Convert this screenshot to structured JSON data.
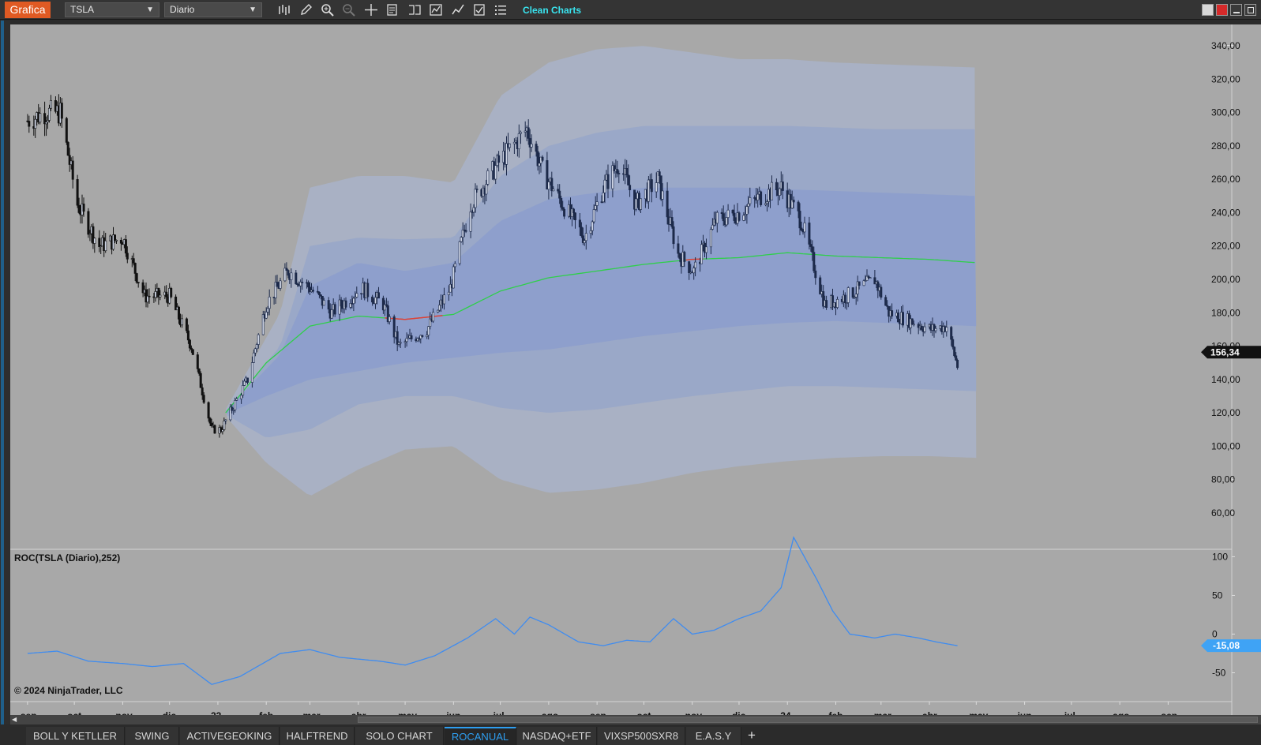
{
  "toolbar": {
    "brand": "Grafica",
    "instrument": "TSLA",
    "period": "Diario",
    "clean_charts": "Clean Charts",
    "tools": [
      "bar-type-icon",
      "pencil-icon",
      "zoom-in-icon",
      "zoom-out-icon",
      "crosshair-icon",
      "properties-icon",
      "strategies-icon",
      "indicators-icon",
      "chart-trader-icon",
      "templates-icon",
      "list-icon"
    ]
  },
  "colors": {
    "brand": "#e05a23",
    "accent_cyan": "#39e4ef",
    "chart_bg": "#a8a8a8",
    "band_outer": "#a9b1c4",
    "band_mid": "#9aa8c8",
    "band_inner": "#8e9fcc",
    "ma_up": "#2fcf4a",
    "ma_down": "#e0403a",
    "roc_line": "#3f8cf0",
    "last_price_badge": "#111111",
    "roc_badge": "#3fa3f5"
  },
  "price_panel": {
    "y_ticks": [
      "340,00",
      "320,00",
      "300,00",
      "280,00",
      "260,00",
      "240,00",
      "220,00",
      "200,00",
      "180,00",
      "160,00",
      "140,00",
      "120,00",
      "100,00",
      "80,00",
      "60,00"
    ],
    "last_price": "156,34",
    "nav_arrow": "←"
  },
  "roc_panel": {
    "title": "ROC(TSLA (Diario),252)",
    "y_ticks": [
      "100",
      "50",
      "0",
      "-50"
    ],
    "last_value": "-15,08",
    "copyright": "© 2024 NinjaTrader, LLC"
  },
  "x_axis": {
    "labels": [
      "sep",
      "oct",
      "nov",
      "dic",
      "23",
      "feb",
      "mar",
      "abr",
      "may",
      "jun",
      "jul",
      "ago",
      "sep",
      "oct",
      "nov",
      "dic",
      "24",
      "feb",
      "mar",
      "abr",
      "may",
      "jun",
      "jul",
      "ago",
      "sep"
    ]
  },
  "tabs": [
    {
      "label": "BOLL Y KETLLER",
      "active": false
    },
    {
      "label": "SWING",
      "active": false
    },
    {
      "label": "ACTIVEGEOKING",
      "active": false
    },
    {
      "label": "HALFTREND",
      "active": false
    },
    {
      "label": "SOLO CHART",
      "active": false
    },
    {
      "label": "ROCANUAL",
      "active": true
    },
    {
      "label": "NASDAQ+ETF",
      "active": false
    },
    {
      "label": "VIXSP500SXR8",
      "active": false
    },
    {
      "label": "E.A.S.Y",
      "active": false
    }
  ],
  "tab_add": "+",
  "chart_data": {
    "type": "candlestick",
    "instrument": "TSLA",
    "price_ylim": [
      50,
      350
    ],
    "price_anchors": [
      [
        "2022-09-01",
        295
      ],
      [
        "2022-09-12",
        300
      ],
      [
        "2022-09-22",
        300
      ],
      [
        "2022-10-03",
        245
      ],
      [
        "2022-10-17",
        220
      ],
      [
        "2022-11-01",
        225
      ],
      [
        "2022-11-15",
        190
      ],
      [
        "2022-12-01",
        190
      ],
      [
        "2022-12-15",
        160
      ],
      [
        "2022-12-28",
        110
      ],
      [
        "2023-01-03",
        110
      ],
      [
        "2023-01-20",
        140
      ],
      [
        "2023-02-01",
        185
      ],
      [
        "2023-02-15",
        205
      ],
      [
        "2023-03-01",
        195
      ],
      [
        "2023-03-15",
        180
      ],
      [
        "2023-04-03",
        195
      ],
      [
        "2023-04-17",
        185
      ],
      [
        "2023-04-27",
        160
      ],
      [
        "2023-05-15",
        170
      ],
      [
        "2023-05-30",
        195
      ],
      [
        "2023-06-12",
        245
      ],
      [
        "2023-06-30",
        270
      ],
      [
        "2023-07-18",
        290
      ],
      [
        "2023-07-28",
        265
      ],
      [
        "2023-08-10",
        245
      ],
      [
        "2023-08-24",
        225
      ],
      [
        "2023-09-05",
        255
      ],
      [
        "2023-09-15",
        270
      ],
      [
        "2023-09-26",
        245
      ],
      [
        "2023-10-10",
        260
      ],
      [
        "2023-10-23",
        215
      ],
      [
        "2023-11-02",
        205
      ],
      [
        "2023-11-16",
        235
      ],
      [
        "2023-12-01",
        240
      ],
      [
        "2023-12-15",
        250
      ],
      [
        "2023-12-28",
        255
      ],
      [
        "2024-01-10",
        235
      ],
      [
        "2024-01-25",
        185
      ],
      [
        "2024-02-08",
        190
      ],
      [
        "2024-02-26",
        200
      ],
      [
        "2024-03-06",
        180
      ],
      [
        "2024-03-20",
        175
      ],
      [
        "2024-04-02",
        170
      ],
      [
        "2024-04-12",
        172
      ],
      [
        "2024-04-19",
        148
      ]
    ],
    "last_close": 156.34,
    "ma_anchors": [
      [
        "2023-01-06",
        120
      ],
      [
        "2023-02-01",
        150
      ],
      [
        "2023-03-01",
        172
      ],
      [
        "2023-04-01",
        178
      ],
      [
        "2023-05-01",
        176
      ],
      [
        "2023-06-01",
        179
      ],
      [
        "2023-07-01",
        193
      ],
      [
        "2023-08-01",
        201
      ],
      [
        "2023-09-01",
        205
      ],
      [
        "2023-10-01",
        209
      ],
      [
        "2023-11-01",
        212
      ],
      [
        "2023-12-01",
        213
      ],
      [
        "2024-01-01",
        216
      ],
      [
        "2024-02-01",
        214
      ],
      [
        "2024-03-01",
        213
      ],
      [
        "2024-04-01",
        212
      ],
      [
        "2024-05-01",
        210
      ]
    ],
    "ma_red_segments": [
      [
        "2023-04-18",
        "2023-05-25"
      ],
      [
        "2023-10-28",
        "2023-11-08"
      ]
    ],
    "band_outer_top": [
      [
        "2023-01-06",
        122
      ],
      [
        "2023-02-10",
        180
      ],
      [
        "2023-03-01",
        255
      ],
      [
        "2023-04-01",
        262
      ],
      [
        "2023-05-01",
        262
      ],
      [
        "2023-06-01",
        258
      ],
      [
        "2023-07-01",
        310
      ],
      [
        "2023-08-01",
        330
      ],
      [
        "2023-09-01",
        338
      ],
      [
        "2023-10-01",
        340
      ],
      [
        "2023-11-01",
        336
      ],
      [
        "2023-12-01",
        332
      ],
      [
        "2024-01-01",
        332
      ],
      [
        "2024-02-01",
        330
      ],
      [
        "2024-03-01",
        329
      ],
      [
        "2024-04-01",
        328
      ],
      [
        "2024-05-01",
        327
      ]
    ],
    "band_outer_bottom": [
      [
        "2023-01-06",
        118
      ],
      [
        "2023-02-01",
        90
      ],
      [
        "2023-03-01",
        70
      ],
      [
        "2023-04-01",
        86
      ],
      [
        "2023-05-01",
        98
      ],
      [
        "2023-06-01",
        100
      ],
      [
        "2023-07-01",
        80
      ],
      [
        "2023-08-01",
        72
      ],
      [
        "2023-09-01",
        74
      ],
      [
        "2023-10-01",
        78
      ],
      [
        "2023-11-01",
        84
      ],
      [
        "2023-12-01",
        88
      ],
      [
        "2024-01-01",
        91
      ],
      [
        "2024-02-01",
        93
      ],
      [
        "2024-03-01",
        94
      ],
      [
        "2024-04-01",
        94
      ],
      [
        "2024-05-01",
        93
      ]
    ],
    "band_mid_top": [
      [
        "2023-01-06",
        121
      ],
      [
        "2023-02-10",
        160
      ],
      [
        "2023-03-01",
        220
      ],
      [
        "2023-04-01",
        225
      ],
      [
        "2023-05-01",
        224
      ],
      [
        "2023-06-01",
        225
      ],
      [
        "2023-07-01",
        262
      ],
      [
        "2023-08-01",
        280
      ],
      [
        "2023-09-01",
        288
      ],
      [
        "2023-10-01",
        292
      ],
      [
        "2023-11-01",
        292
      ],
      [
        "2023-12-01",
        292
      ],
      [
        "2024-01-01",
        292
      ],
      [
        "2024-02-01",
        291
      ],
      [
        "2024-03-01",
        290
      ],
      [
        "2024-04-01",
        290
      ],
      [
        "2024-05-01",
        290
      ]
    ],
    "band_mid_bottom": [
      [
        "2023-01-06",
        119
      ],
      [
        "2023-02-01",
        105
      ],
      [
        "2023-03-01",
        110
      ],
      [
        "2023-04-01",
        125
      ],
      [
        "2023-05-01",
        130
      ],
      [
        "2023-06-01",
        130
      ],
      [
        "2023-07-01",
        123
      ],
      [
        "2023-08-01",
        120
      ],
      [
        "2023-09-01",
        122
      ],
      [
        "2023-10-01",
        126
      ],
      [
        "2023-11-01",
        130
      ],
      [
        "2023-12-01",
        133
      ],
      [
        "2024-01-01",
        136
      ],
      [
        "2024-02-01",
        136
      ],
      [
        "2024-03-01",
        135
      ],
      [
        "2024-04-01",
        134
      ],
      [
        "2024-05-01",
        133
      ]
    ],
    "band_inner_top": [
      [
        "2023-01-06",
        121
      ],
      [
        "2023-02-10",
        155
      ],
      [
        "2023-03-01",
        196
      ],
      [
        "2023-04-01",
        210
      ],
      [
        "2023-05-01",
        205
      ],
      [
        "2023-06-01",
        210
      ],
      [
        "2023-07-01",
        235
      ],
      [
        "2023-08-01",
        248
      ],
      [
        "2023-09-01",
        252
      ],
      [
        "2023-10-01",
        255
      ],
      [
        "2023-11-01",
        255
      ],
      [
        "2023-12-01",
        255
      ],
      [
        "2024-01-01",
        254
      ],
      [
        "2024-02-01",
        253
      ],
      [
        "2024-03-01",
        252
      ],
      [
        "2024-04-01",
        251
      ],
      [
        "2024-05-01",
        250
      ]
    ],
    "band_inner_bottom": [
      [
        "2023-01-06",
        119
      ],
      [
        "2023-02-01",
        130
      ],
      [
        "2023-03-01",
        140
      ],
      [
        "2023-04-01",
        145
      ],
      [
        "2023-05-01",
        150
      ],
      [
        "2023-06-01",
        153
      ],
      [
        "2023-07-01",
        156
      ],
      [
        "2023-08-01",
        158
      ],
      [
        "2023-09-01",
        162
      ],
      [
        "2023-10-01",
        166
      ],
      [
        "2023-11-01",
        169
      ],
      [
        "2023-12-01",
        172
      ],
      [
        "2024-01-01",
        174
      ],
      [
        "2024-02-01",
        175
      ],
      [
        "2024-03-01",
        174
      ],
      [
        "2024-04-01",
        173
      ],
      [
        "2024-05-01",
        172
      ]
    ],
    "roc_ylim": [
      -75,
      130
    ],
    "roc_anchors": [
      [
        "2022-09-01",
        -25
      ],
      [
        "2022-09-20",
        -22
      ],
      [
        "2022-10-10",
        -35
      ],
      [
        "2022-11-01",
        -38
      ],
      [
        "2022-11-20",
        -42
      ],
      [
        "2022-12-10",
        -38
      ],
      [
        "2022-12-28",
        -65
      ],
      [
        "2023-01-15",
        -55
      ],
      [
        "2023-02-10",
        -25
      ],
      [
        "2023-03-01",
        -20
      ],
      [
        "2023-03-20",
        -30
      ],
      [
        "2023-04-15",
        -35
      ],
      [
        "2023-05-01",
        -40
      ],
      [
        "2023-05-20",
        -28
      ],
      [
        "2023-06-10",
        -5
      ],
      [
        "2023-06-28",
        20
      ],
      [
        "2023-07-10",
        0
      ],
      [
        "2023-07-20",
        22
      ],
      [
        "2023-08-01",
        12
      ],
      [
        "2023-08-20",
        -10
      ],
      [
        "2023-09-05",
        -15
      ],
      [
        "2023-09-20",
        -8
      ],
      [
        "2023-10-05",
        -10
      ],
      [
        "2023-10-20",
        20
      ],
      [
        "2023-11-01",
        0
      ],
      [
        "2023-11-15",
        5
      ],
      [
        "2023-12-01",
        20
      ],
      [
        "2023-12-15",
        30
      ],
      [
        "2023-12-28",
        60
      ],
      [
        "2024-01-05",
        125
      ],
      [
        "2024-01-20",
        70
      ],
      [
        "2024-01-30",
        30
      ],
      [
        "2024-02-10",
        0
      ],
      [
        "2024-02-26",
        -5
      ],
      [
        "2024-03-10",
        0
      ],
      [
        "2024-03-25",
        -5
      ],
      [
        "2024-04-05",
        -10
      ],
      [
        "2024-04-19",
        -15
      ]
    ],
    "x_range": [
      "2022-08-26",
      "2024-09-18"
    ]
  }
}
